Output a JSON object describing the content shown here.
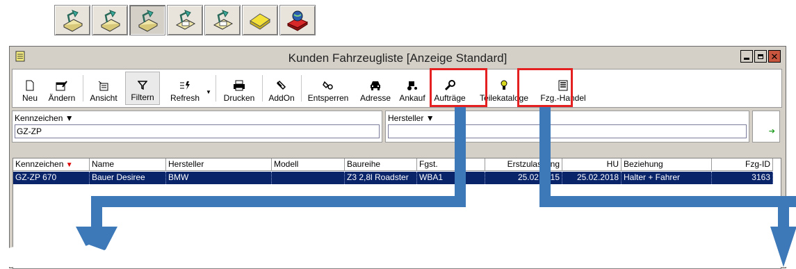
{
  "launcher": {
    "buttons": [
      {
        "icon": "desk-lamp-app-icon"
      },
      {
        "icon": "desk-lamp-app-icon"
      },
      {
        "icon": "desk-lamp-app-icon",
        "pressed": true
      },
      {
        "icon": "desk-lamp-card-app-icon"
      },
      {
        "icon": "desk-lamp-card-app-icon"
      },
      {
        "icon": "yellow-eraser-icon"
      },
      {
        "icon": "globe-red-book-icon"
      }
    ]
  },
  "window": {
    "title": "Kunden Fahrzeugliste [Anzeige Standard]"
  },
  "toolbar": {
    "neu": "Neu",
    "aendern": "Ändern",
    "ansicht": "Ansicht",
    "filtern": "Filtern",
    "refresh": "Refresh",
    "drucken": "Drucken",
    "addon": "AddOn",
    "entsperren": "Entsperren",
    "adresse": "Adresse",
    "ankauf": "Ankauf",
    "auftraege": "Aufträge",
    "teilekataloge": "Teilekataloge",
    "fzg_handel": "Fzg.-Handel"
  },
  "filters": {
    "kennzeichen_label": "Kennzeichen",
    "kennzeichen_value": "GZ-ZP",
    "hersteller_label": "Hersteller",
    "hersteller_value": ""
  },
  "grid": {
    "columns": [
      "Kennzeichen",
      "Name",
      "Hersteller",
      "Modell",
      "Baureihe",
      "Fgst.",
      "Erstzulassung",
      "HU",
      "Beziehung",
      "Fzg-ID"
    ],
    "rows": [
      [
        "GZ-ZP 670",
        "Bauer Desiree",
        "BMW",
        "",
        "Z3 2,8l Roadster",
        "WBA1",
        "25.02.2015",
        "25.02.2018",
        "Halter + Fahrer",
        "3163"
      ]
    ]
  },
  "colors": {
    "highlight": "#e52021",
    "arrow": "#3d79b8",
    "selection": "#0a246a"
  }
}
